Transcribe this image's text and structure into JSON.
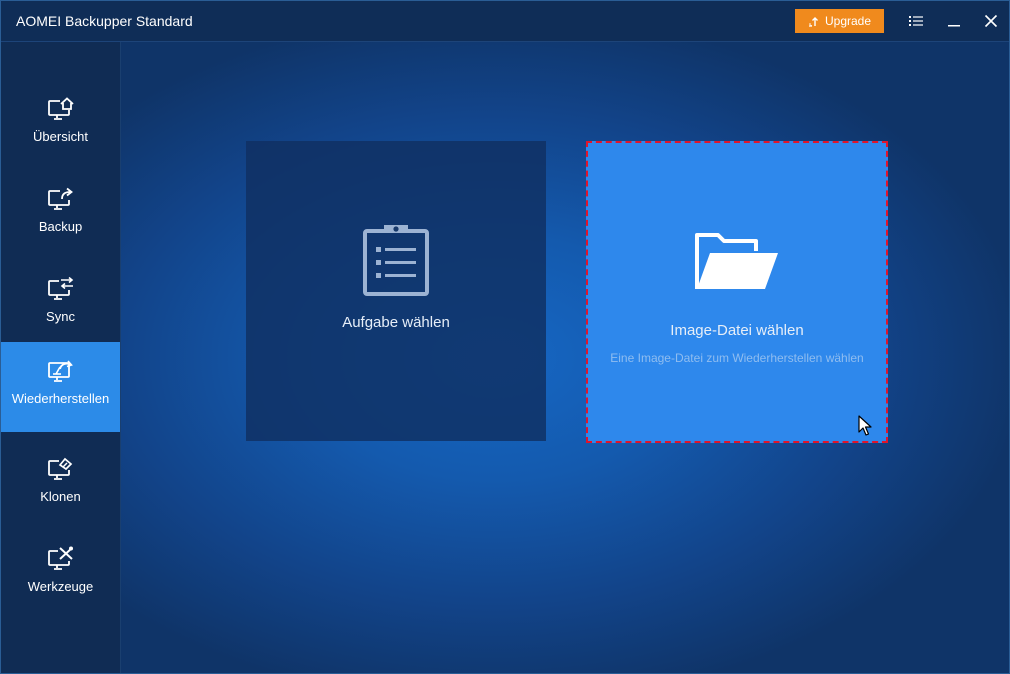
{
  "window": {
    "title": "AOMEI Backupper Standard"
  },
  "titlebar": {
    "upgrade_label": "Upgrade",
    "accent": "#f08a1d",
    "buttons": [
      "menu-icon",
      "minimize-icon",
      "close-icon"
    ]
  },
  "sidebar": {
    "items": [
      {
        "label": "Übersicht",
        "icon": "monitor-home-icon",
        "active": false
      },
      {
        "label": "Backup",
        "icon": "monitor-share-icon",
        "active": false
      },
      {
        "label": "Sync",
        "icon": "monitor-sync-icon",
        "active": false
      },
      {
        "label": "Wiederherstellen",
        "icon": "monitor-restore-icon",
        "active": true
      },
      {
        "label": "Klonen",
        "icon": "monitor-clone-icon",
        "active": false
      },
      {
        "label": "Werkzeuge",
        "icon": "monitor-tools-icon",
        "active": false
      }
    ],
    "active_color": "#2c8be8"
  },
  "main": {
    "cards": [
      {
        "title": "Aufgabe wählen",
        "icon": "clipboard-list-icon"
      },
      {
        "title": "Image-Datei wählen",
        "subtitle": "Eine Image-Datei zum Wiederherstellen wählen",
        "icon": "folder-open-icon",
        "highlight": "#e0152c"
      }
    ]
  }
}
